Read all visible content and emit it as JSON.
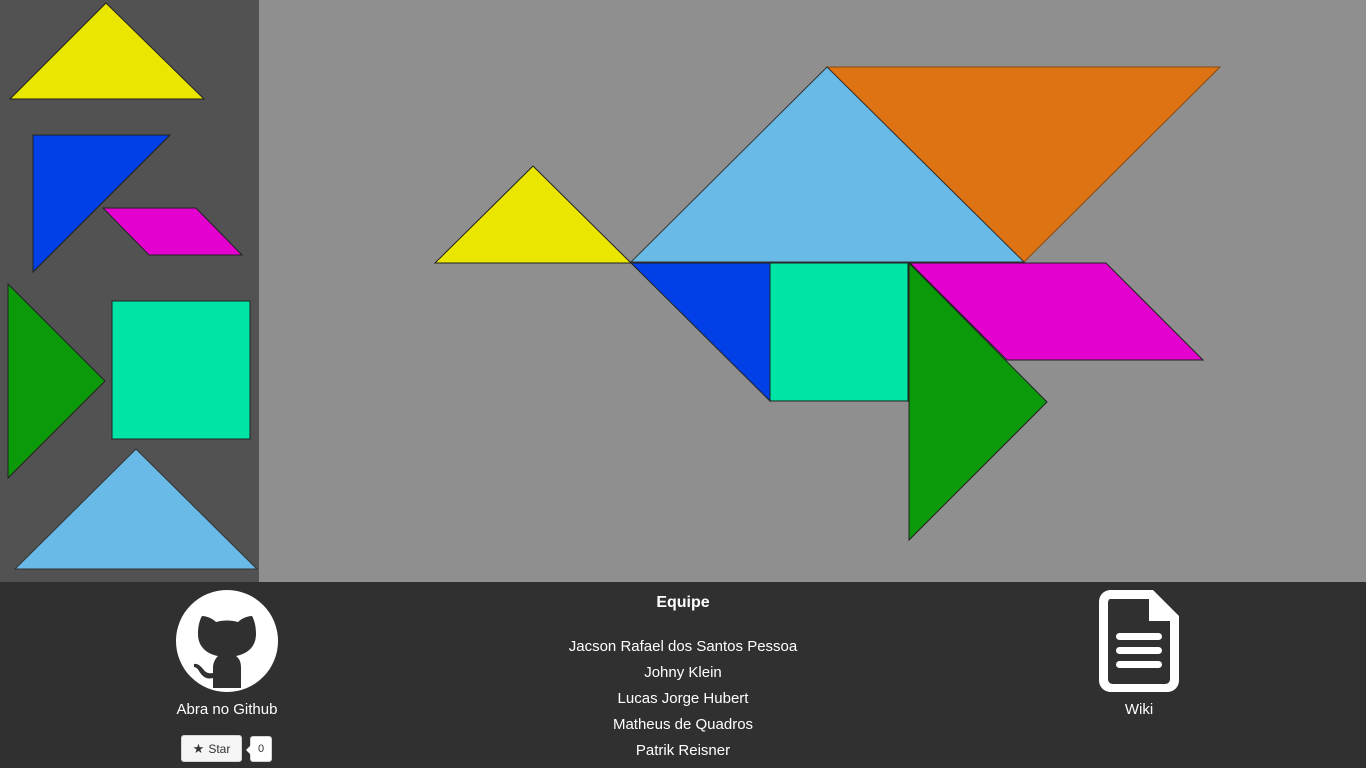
{
  "colors": {
    "yellow": "#eae600",
    "blue": "#0040e6",
    "magenta": "#e400cf",
    "green": "#0a9a0a",
    "teal": "#00e4a5",
    "light_blue": "#69bae6",
    "orange": "#de7314",
    "sidebar_bg": "#525252",
    "board_bg": "#8f8f8f",
    "footer_bg": "#303030"
  },
  "sidebar_pieces": [
    {
      "name": "small-yellow-triangle",
      "color": "yellow"
    },
    {
      "name": "medium-blue-triangle",
      "color": "blue"
    },
    {
      "name": "magenta-parallelogram",
      "color": "magenta"
    },
    {
      "name": "large-green-triangle",
      "color": "green"
    },
    {
      "name": "teal-square",
      "color": "teal"
    },
    {
      "name": "large-light-blue-triangle",
      "color": "light_blue"
    }
  ],
  "footer": {
    "github_label": "Abra no Github",
    "star_label": "Star",
    "star_count": "0",
    "team_title": "Equipe",
    "team_members": [
      "Jacson Rafael dos Santos Pessoa",
      "Johny Klein",
      "Lucas Jorge Hubert",
      "Matheus de Quadros",
      "Patrik Reisner"
    ],
    "wiki_label": "Wiki"
  }
}
